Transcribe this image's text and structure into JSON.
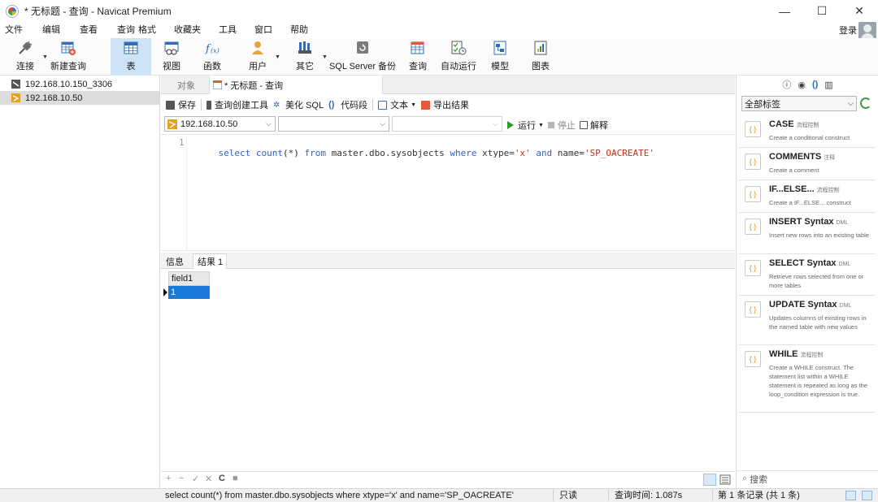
{
  "window": {
    "title": "* 无标题 - 查询 - Navicat Premium",
    "controls": {
      "minimize": "—",
      "maximize": "☐",
      "close": "✕"
    }
  },
  "menu": [
    "文件",
    "编辑",
    "查看",
    "查询",
    "格式",
    "收藏夹",
    "工具",
    "窗口",
    "帮助"
  ],
  "account": {
    "login_label": "登录"
  },
  "toolbar": {
    "connect": "连接",
    "new_query": "新建查询",
    "table": "表",
    "view": "视图",
    "function": "函数",
    "user": "用户",
    "other": "其它",
    "backup": "SQL Server 备份",
    "query": "查询",
    "automation": "自动运行",
    "model": "模型",
    "chart": "图表"
  },
  "connections": [
    {
      "label": "192.168.10.150_3306",
      "icon": "mysql-connection-icon",
      "color": "#555555"
    },
    {
      "label": "192.168.10.50",
      "icon": "sqlserver-connection-icon",
      "color": "#e8a020"
    }
  ],
  "tabs": [
    {
      "label": "对象"
    },
    {
      "label": "* 无标题 - 查询"
    }
  ],
  "editor_toolbar": {
    "save": "保存",
    "query_builder": "查询创建工具",
    "beautify": "美化 SQL",
    "snippet": "代码段",
    "text": "文本",
    "export": "导出结果"
  },
  "connection_selectors": {
    "connection": "192.168.10.50",
    "database": "",
    "schema": "",
    "run": "运行",
    "stop": "停止",
    "explain": "解释"
  },
  "editor": {
    "line_number": "1",
    "tokens": [
      {
        "t": "select",
        "c": "kw"
      },
      {
        "t": " ",
        "c": "pl"
      },
      {
        "t": "count",
        "c": "kw"
      },
      {
        "t": "(*) ",
        "c": "pl"
      },
      {
        "t": "from",
        "c": "kw"
      },
      {
        "t": " master.dbo.sysobjects ",
        "c": "pl"
      },
      {
        "t": "where",
        "c": "kw"
      },
      {
        "t": " xtype=",
        "c": "pl"
      },
      {
        "t": "'x'",
        "c": "str"
      },
      {
        "t": " ",
        "c": "pl"
      },
      {
        "t": "and",
        "c": "kw"
      },
      {
        "t": " name=",
        "c": "pl"
      },
      {
        "t": "'SP_OACREATE'",
        "c": "str"
      }
    ]
  },
  "result_tabs": [
    {
      "label": "信息"
    },
    {
      "label": "结果 1"
    }
  ],
  "grid": {
    "columns": [
      "field1"
    ],
    "rows": [
      [
        "1"
      ]
    ]
  },
  "grid_footer": {
    "add": "+",
    "remove": "−",
    "apply": "✓",
    "discard": "✕",
    "refresh": "C",
    "stop": "■"
  },
  "right_panel": {
    "tag_filter": "全部标签",
    "snippets": [
      {
        "title": "CASE",
        "tag": "流程控制",
        "desc": "Create a conditional construct"
      },
      {
        "title": "COMMENTS",
        "tag": "注释",
        "desc": "Create a comment"
      },
      {
        "title": "IF...ELSE...",
        "tag": "流程控制",
        "desc": "Create a IF...ELSE... construct"
      },
      {
        "title": "INSERT Syntax",
        "tag": "DML",
        "desc": "Insert new rows into an existing table"
      },
      {
        "title": "SELECT Syntax",
        "tag": "DML",
        "desc": "Retrieve rows selected from one or more tables"
      },
      {
        "title": "UPDATE Syntax",
        "tag": "DML",
        "desc": "Updates columns of existing rows in the named table with new values"
      },
      {
        "title": "WHILE",
        "tag": "流程控制",
        "desc": "Create a WHILE construct. The statement list within a WHILE statement is repeated as long as the loop_condition expression is true."
      }
    ],
    "search_placeholder": "搜索"
  },
  "statusbar": {
    "sql": "select count(*) from master.dbo.sysobjects where xtype='x' and name='SP_OACREATE'",
    "readonly": "只读",
    "query_time": "查询时间: 1.087s",
    "records": "第 1 条记录 (共 1 条)"
  },
  "colors": {
    "selected_tab": "#cfe3f7",
    "keyword": "#2f5fd0",
    "string": "#c4301a",
    "grid_selection": "#1a7ad8",
    "run_green": "#2e9b2e"
  }
}
